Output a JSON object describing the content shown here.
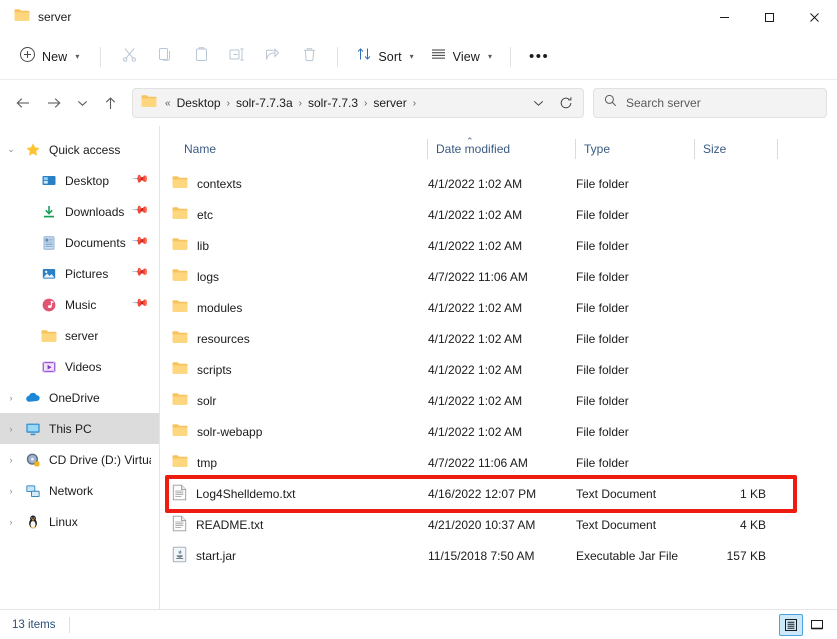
{
  "window": {
    "tab_title": "server",
    "tab_icon": "folder-icon",
    "minimize_label": "—",
    "maximize_label": "□",
    "close_label": "✕"
  },
  "toolbar": {
    "new_label": "New",
    "sort_label": "Sort",
    "view_label": "View",
    "more_label": "•••",
    "items": [
      {
        "name": "new-button",
        "icon": "plus-circle-icon"
      },
      {
        "name": "cut-button",
        "icon": "scissors-icon"
      },
      {
        "name": "copy-button",
        "icon": "copy-icon"
      },
      {
        "name": "paste-button",
        "icon": "clipboard-icon"
      },
      {
        "name": "rename-button",
        "icon": "rename-icon"
      },
      {
        "name": "share-button",
        "icon": "share-icon"
      },
      {
        "name": "delete-button",
        "icon": "trash-icon"
      },
      {
        "name": "sort-button",
        "icon": "sort-arrows-icon"
      },
      {
        "name": "view-button",
        "icon": "list-lines-icon"
      },
      {
        "name": "more-button",
        "icon": "ellipsis-icon"
      }
    ]
  },
  "navigation": {
    "back_icon": "arrow-left-icon",
    "forward_icon": "arrow-right-icon",
    "recent_icon": "chevron-down-icon",
    "up_icon": "arrow-up-icon",
    "refresh_icon": "refresh-icon",
    "address_dropdown_icon": "chevron-down-icon",
    "breadcrumb_prefix": "«",
    "breadcrumbs": [
      "Desktop",
      "solr-7.7.3a",
      "solr-7.7.3",
      "server"
    ],
    "breadcrumb_separator": "›"
  },
  "search": {
    "placeholder": "Search server",
    "value": "",
    "icon": "search-icon"
  },
  "sidebar": {
    "items": [
      {
        "label": "Quick access",
        "icon": "star-icon",
        "twisty": "⌄",
        "expanded": true,
        "indent": false,
        "pinned": false,
        "selected": false
      },
      {
        "label": "Desktop",
        "icon": "desktop-icon",
        "twisty": "",
        "expanded": false,
        "indent": true,
        "pinned": true,
        "selected": false
      },
      {
        "label": "Downloads",
        "icon": "download-icon",
        "twisty": "",
        "expanded": false,
        "indent": true,
        "pinned": true,
        "selected": false
      },
      {
        "label": "Documents",
        "icon": "documents-icon",
        "twisty": "",
        "expanded": false,
        "indent": true,
        "pinned": true,
        "selected": false
      },
      {
        "label": "Pictures",
        "icon": "pictures-icon",
        "twisty": "",
        "expanded": false,
        "indent": true,
        "pinned": true,
        "selected": false
      },
      {
        "label": "Music",
        "icon": "music-icon",
        "twisty": "",
        "expanded": false,
        "indent": true,
        "pinned": true,
        "selected": false
      },
      {
        "label": "server",
        "icon": "folder-icon",
        "twisty": "",
        "expanded": false,
        "indent": true,
        "pinned": false,
        "selected": false
      },
      {
        "label": "Videos",
        "icon": "videos-icon",
        "twisty": "",
        "expanded": false,
        "indent": true,
        "pinned": false,
        "selected": false
      },
      {
        "label": "OneDrive",
        "icon": "cloud-icon",
        "twisty": "›",
        "expanded": false,
        "indent": false,
        "pinned": false,
        "selected": false
      },
      {
        "label": "This PC",
        "icon": "monitor-icon",
        "twisty": "›",
        "expanded": false,
        "indent": false,
        "pinned": false,
        "selected": true
      },
      {
        "label": "CD Drive (D:) Virtual",
        "icon": "disc-icon",
        "twisty": "›",
        "expanded": false,
        "indent": false,
        "pinned": false,
        "selected": false
      },
      {
        "label": "Network",
        "icon": "network-icon",
        "twisty": "›",
        "expanded": false,
        "indent": false,
        "pinned": false,
        "selected": false
      },
      {
        "label": "Linux",
        "icon": "penguin-icon",
        "twisty": "›",
        "expanded": false,
        "indent": false,
        "pinned": false,
        "selected": false
      }
    ]
  },
  "file_list": {
    "columns": [
      {
        "label": "Name",
        "key": "name"
      },
      {
        "label": "Date modified",
        "key": "date"
      },
      {
        "label": "Type",
        "key": "type"
      },
      {
        "label": "Size",
        "key": "size"
      }
    ],
    "sort_column": "Name",
    "sort_direction": "ascending",
    "sort_caret": "⌃",
    "rows": [
      {
        "name": "contexts",
        "date": "4/1/2022 1:02 AM",
        "type": "File folder",
        "size": "",
        "icon": "folder-icon",
        "highlighted": false
      },
      {
        "name": "etc",
        "date": "4/1/2022 1:02 AM",
        "type": "File folder",
        "size": "",
        "icon": "folder-icon",
        "highlighted": false
      },
      {
        "name": "lib",
        "date": "4/1/2022 1:02 AM",
        "type": "File folder",
        "size": "",
        "icon": "folder-icon",
        "highlighted": false
      },
      {
        "name": "logs",
        "date": "4/7/2022 11:06 AM",
        "type": "File folder",
        "size": "",
        "icon": "folder-icon",
        "highlighted": false
      },
      {
        "name": "modules",
        "date": "4/1/2022 1:02 AM",
        "type": "File folder",
        "size": "",
        "icon": "folder-icon",
        "highlighted": false
      },
      {
        "name": "resources",
        "date": "4/1/2022 1:02 AM",
        "type": "File folder",
        "size": "",
        "icon": "folder-icon",
        "highlighted": false
      },
      {
        "name": "scripts",
        "date": "4/1/2022 1:02 AM",
        "type": "File folder",
        "size": "",
        "icon": "folder-icon",
        "highlighted": false
      },
      {
        "name": "solr",
        "date": "4/1/2022 1:02 AM",
        "type": "File folder",
        "size": "",
        "icon": "folder-icon",
        "highlighted": false
      },
      {
        "name": "solr-webapp",
        "date": "4/1/2022 1:02 AM",
        "type": "File folder",
        "size": "",
        "icon": "folder-icon",
        "highlighted": false
      },
      {
        "name": "tmp",
        "date": "4/7/2022 11:06 AM",
        "type": "File folder",
        "size": "",
        "icon": "folder-icon",
        "highlighted": false
      },
      {
        "name": "Log4Shelldemo.txt",
        "date": "4/16/2022 12:07 PM",
        "type": "Text Document",
        "size": "1 KB",
        "icon": "text-file-icon",
        "highlighted": true
      },
      {
        "name": "README.txt",
        "date": "4/21/2020 10:37 AM",
        "type": "Text Document",
        "size": "4 KB",
        "icon": "text-file-icon",
        "highlighted": false
      },
      {
        "name": "start.jar",
        "date": "11/15/2018 7:50 AM",
        "type": "Executable Jar File",
        "size": "157 KB",
        "icon": "jar-file-icon",
        "highlighted": false
      }
    ]
  },
  "status_bar": {
    "item_count": "13 items",
    "details_view_icon": "details-view-icon",
    "large_icons_view_icon": "large-icons-view-icon",
    "active_view": "details"
  },
  "colors": {
    "annotation_red": "#ee1b11",
    "folder_yellow": "#fcc44c",
    "selection_gray": "#dcdcdc",
    "accent_blue": "#0f6cbd",
    "header_text_blue": "#3a5a82"
  }
}
